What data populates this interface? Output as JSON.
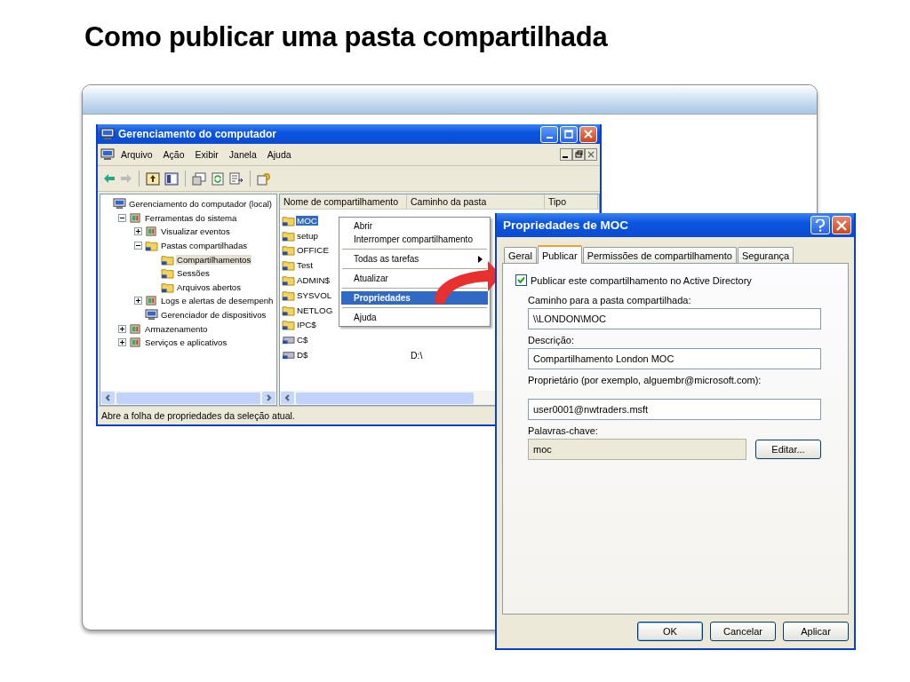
{
  "slide_title": "Como publicar uma pasta compartilhada",
  "main_window": {
    "title": "Gerenciamento do computador",
    "menu": [
      "Arquivo",
      "Ação",
      "Exibir",
      "Janela",
      "Ajuda"
    ],
    "tree": [
      {
        "label": "Gerenciamento do computador (local)",
        "kind": "computer",
        "selected": false,
        "children": [
          {
            "label": "Ferramentas do sistema",
            "kind": "tool",
            "expanded": true,
            "selected": false,
            "children": [
              {
                "label": "Visualizar eventos",
                "kind": "tool",
                "expanded": false,
                "selected": false
              },
              {
                "label": "Pastas compartilhadas",
                "kind": "folder",
                "expanded": true,
                "selected": false,
                "children": [
                  {
                    "label": "Compartilhamentos",
                    "kind": "folder",
                    "selected": true
                  },
                  {
                    "label": "Sessões",
                    "kind": "folder",
                    "selected": false
                  },
                  {
                    "label": "Arquivos abertos",
                    "kind": "folder",
                    "selected": false
                  }
                ]
              },
              {
                "label": "Logs e alertas de desempenh",
                "kind": "tool",
                "expanded": false,
                "selected": false
              },
              {
                "label": "Gerenciador de dispositivos",
                "kind": "computer",
                "selected": false
              }
            ]
          },
          {
            "label": "Armazenamento",
            "kind": "tool",
            "expanded": false,
            "selected": false
          },
          {
            "label": "Serviços e aplicativos",
            "kind": "tool",
            "expanded": false,
            "selected": false
          }
        ]
      }
    ],
    "columns": [
      "Nome de compartilhamento",
      "Caminho da pasta",
      "Tipo"
    ],
    "rows": [
      {
        "name": "MOC",
        "kind": "share",
        "selected": true
      },
      {
        "name": "setup",
        "kind": "share",
        "selected": false
      },
      {
        "name": "OFFICE",
        "kind": "share",
        "selected": false
      },
      {
        "name": "Test",
        "kind": "share",
        "selected": false
      },
      {
        "name": "ADMIN$",
        "kind": "share",
        "selected": false
      },
      {
        "name": "SYSVOL",
        "kind": "share",
        "selected": false
      },
      {
        "name": "NETLOG",
        "kind": "share",
        "selected": false
      },
      {
        "name": "IPC$",
        "kind": "share",
        "selected": false
      },
      {
        "name": "C$",
        "kind": "drive",
        "selected": false
      },
      {
        "name": "D$",
        "kind": "drive",
        "path": "D:\\",
        "selected": false
      }
    ],
    "status": "Abre a folha de propriedades da seleção atual."
  },
  "context_menu": [
    [
      {
        "label": "Abrir",
        "submenu": false,
        "selected": false
      },
      {
        "label": "Interromper compartilhamento",
        "submenu": false,
        "selected": false
      }
    ],
    [
      {
        "label": "Todas as tarefas",
        "submenu": true,
        "selected": false
      }
    ],
    [
      {
        "label": "Atualizar",
        "submenu": false,
        "selected": false
      }
    ],
    [
      {
        "label": "Propriedades",
        "submenu": false,
        "selected": true
      }
    ],
    [
      {
        "label": "Ajuda",
        "submenu": false,
        "selected": false
      }
    ]
  ],
  "dialog": {
    "title": "Propriedades de MOC",
    "tabs": [
      {
        "label": "Geral",
        "selected": false
      },
      {
        "label": "Publicar",
        "selected": true
      },
      {
        "label": "Permissões de compartilhamento",
        "selected": false
      },
      {
        "label": "Segurança",
        "selected": false
      }
    ],
    "publish": {
      "label": "Publicar este compartilhamento no Active Directory",
      "checked": true
    },
    "fields": [
      {
        "label": "Caminho para a pasta compartilhada:",
        "value": "\\\\LONDON\\MOC",
        "readonly": false
      },
      {
        "label": "Descrição:",
        "value": "Compartilhamento London MOC",
        "readonly": false
      },
      {
        "label": "Proprietário (por exemplo, alguembr@microsoft.com):",
        "value": "user0001@nwtraders.msft",
        "readonly": false
      },
      {
        "label": "Palavras-chave:",
        "value": "moc",
        "readonly": true,
        "button": "Editar..."
      }
    ],
    "buttons": [
      "OK",
      "Cancelar",
      "Aplicar"
    ]
  }
}
